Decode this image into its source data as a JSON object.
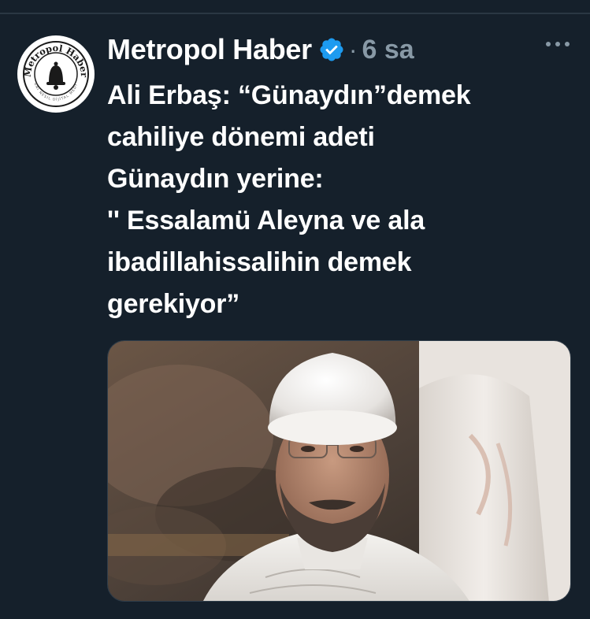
{
  "tweet": {
    "author": {
      "display_name": "Metropol Haber",
      "avatar_logo_text": "Metropol Haber",
      "verified": true,
      "verified_color": "#1d9bf0"
    },
    "separator": "·",
    "time": "6 sa",
    "more_icon": "more-horizontal-icon",
    "text": "Ali Erbaş: “Günaydın”demek\ncahiliye dönemi adeti\nGünaydın yerine:\n'' Essalamü Aleyna ve ala\nibadillahissalihin demek\ngerekiyor”",
    "media": {
      "type": "photo"
    }
  },
  "colors": {
    "background": "#15202b",
    "text": "#ffffff",
    "muted": "#8899a6",
    "accent": "#1d9bf0"
  }
}
